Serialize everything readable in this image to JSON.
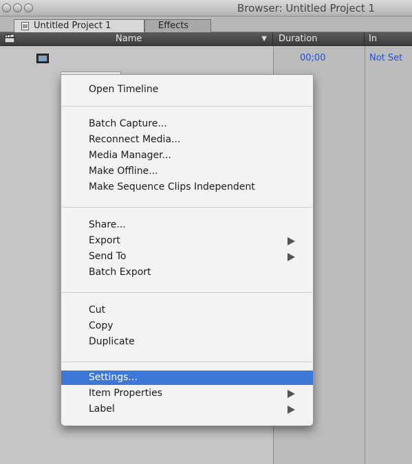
{
  "window": {
    "title": "Browser: Untitled Project 1"
  },
  "tabs": [
    {
      "label": "Untitled Project 1",
      "active": true
    },
    {
      "label": "Effects",
      "active": false
    }
  ],
  "columns": {
    "name": "Name",
    "duration": "Duration",
    "in": "In"
  },
  "row": {
    "duration": "00;00",
    "in": "Not Set"
  },
  "menu": {
    "open_timeline": "Open Timeline",
    "batch_capture": "Batch Capture...",
    "reconnect_media": "Reconnect Media...",
    "media_manager": "Media Manager...",
    "make_offline": "Make Offline...",
    "make_independent": "Make Sequence Clips Independent",
    "share": "Share...",
    "export": "Export",
    "send_to": "Send To",
    "batch_export": "Batch Export",
    "cut": "Cut",
    "copy": "Copy",
    "duplicate": "Duplicate",
    "settings": "Settings...",
    "item_properties": "Item Properties",
    "label": "Label"
  },
  "colors": {
    "selection": "#3d78d6",
    "value_text": "#1e4fd6",
    "header_bg": "#444444"
  }
}
